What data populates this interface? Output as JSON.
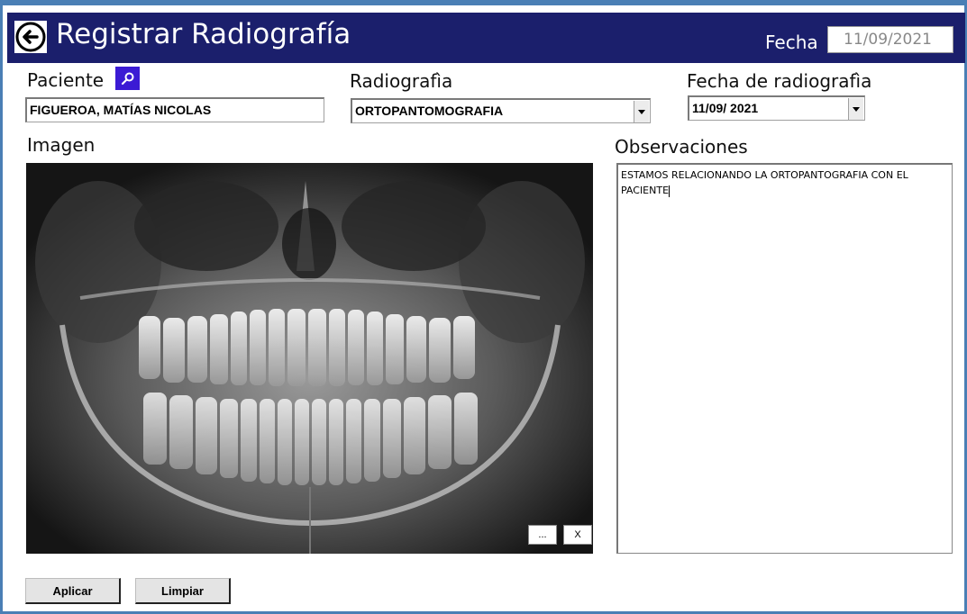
{
  "header": {
    "title": "Registrar Radiografía",
    "fecha_label": "Fecha",
    "fecha_value": "11/09/2021",
    "background_color": "#1b1f6c",
    "back_icon": "arrow-left-circle-icon"
  },
  "patient": {
    "label": "Paciente",
    "search_icon": "search-icon",
    "search_button_color": "#3b1bd4",
    "value": "FIGUEROA, MATÍAS NICOLAS"
  },
  "radiografia": {
    "label": "Radiografìa",
    "selected": "ORTOPANTOMOGRAFIA"
  },
  "fecha_radiografia": {
    "label": "Fecha de radiografìa",
    "value": "11/09/ 2021"
  },
  "imagen": {
    "label": "Imagen",
    "browse_label": "...",
    "clear_label": "X"
  },
  "observaciones": {
    "label": "Observaciones",
    "text": "ESTAMOS RELACIONANDO LA ORTOPANTOGRAFIA CON EL PACIENTE"
  },
  "actions": {
    "apply_label": "Aplicar",
    "clear_label": "Limpiar"
  }
}
